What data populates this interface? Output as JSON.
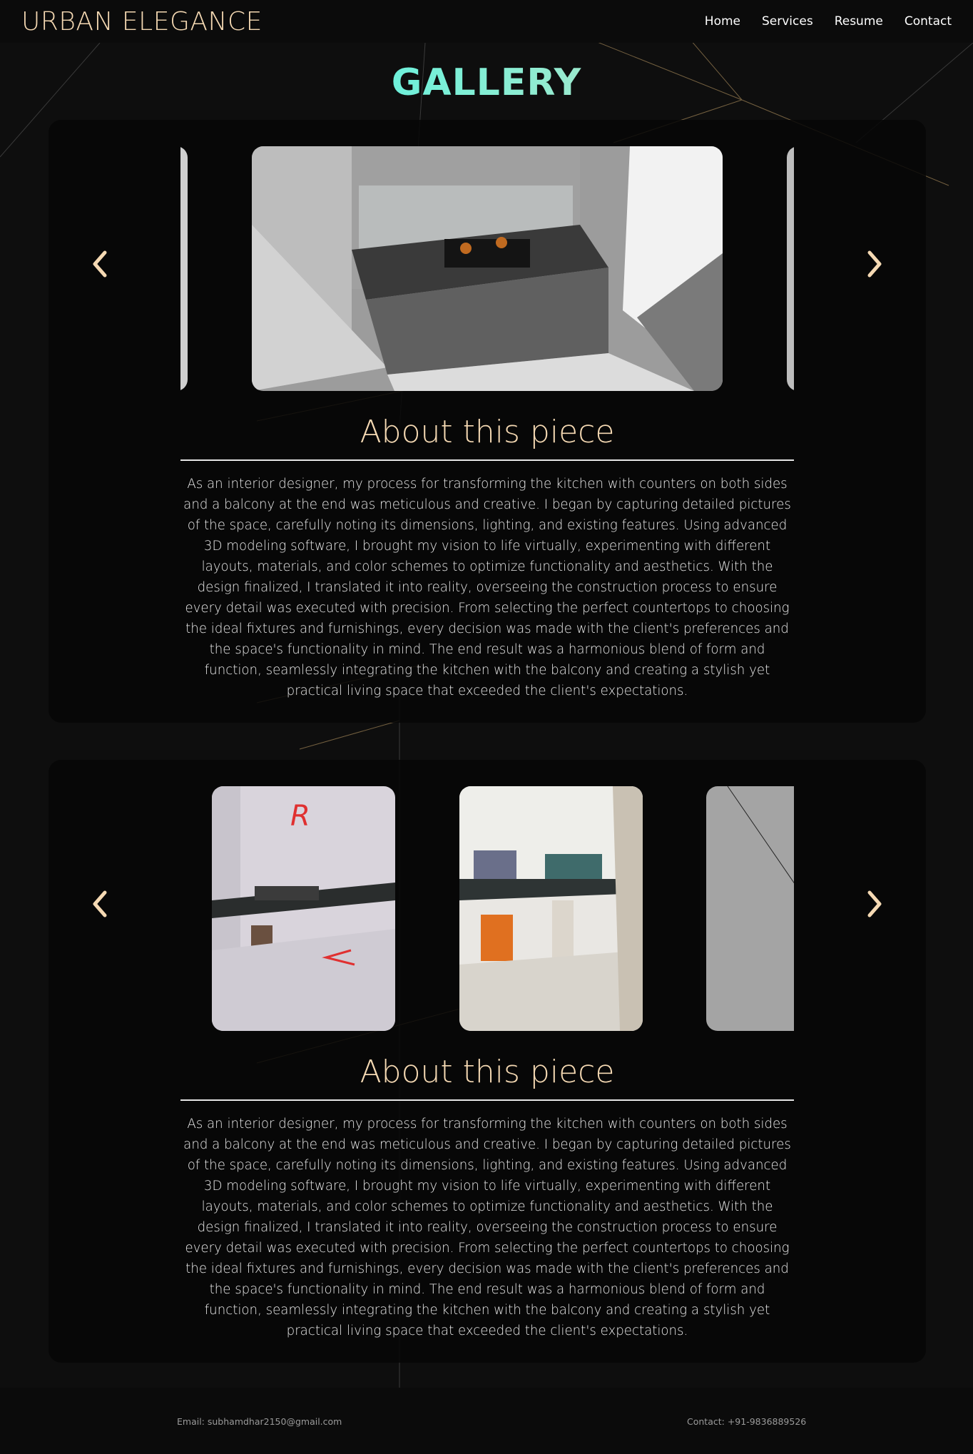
{
  "brand": "URBAN ELEGANCE",
  "nav": [
    "Home",
    "Services",
    "Resume",
    "Contact"
  ],
  "page_title": "GALLERY",
  "galleries": [
    {
      "heading": "About this piece",
      "description": "As an interior designer, my process for transforming the kitchen with counters on both sides and a balcony at the end was meticulous and creative. I began by capturing detailed pictures of the space, carefully noting its dimensions, lighting, and existing features. Using advanced 3D modeling software, I brought my vision to life virtually, experimenting with different layouts, materials, and color schemes to optimize functionality and aesthetics. With the design finalized, I translated it into reality, overseeing the construction process to ensure every detail was executed with precision. From selecting the perfect countertops to choosing the ideal fixtures and furnishings, every decision was made with the client's preferences and the space's functionality in mind. The end result was a harmonious blend of form and function, seamlessly integrating the kitchen with the balcony and creating a stylish yet practical living space that exceeded the client's expectations."
    },
    {
      "heading": "About this piece",
      "description": "As an interior designer, my process for transforming the kitchen with counters on both sides and a balcony at the end was meticulous and creative. I began by capturing detailed pictures of the space, carefully noting its dimensions, lighting, and existing features. Using advanced 3D modeling software, I brought my vision to life virtually, experimenting with different layouts, materials, and color schemes to optimize functionality and aesthetics. With the design finalized, I translated it into reality, overseeing the construction process to ensure every detail was executed with precision. From selecting the perfect countertops to choosing the ideal fixtures and furnishings, every decision was made with the client's preferences and the space's functionality in mind. The end result was a harmonious blend of form and function, seamlessly integrating the kitchen with the balcony and creating a stylish yet practical living space that exceeded the client's expectations."
    }
  ],
  "icons": {
    "prev": "chevron-left-icon",
    "next": "chevron-right-icon"
  },
  "colors": {
    "accent": "#f5d9b3",
    "title_gradient_start": "#0ff0f0",
    "background": "#0e0e0e"
  },
  "footer": {
    "email": "Email: subhamdhar2150@gmail.com",
    "contact": "Contact: +91-9836889526"
  }
}
